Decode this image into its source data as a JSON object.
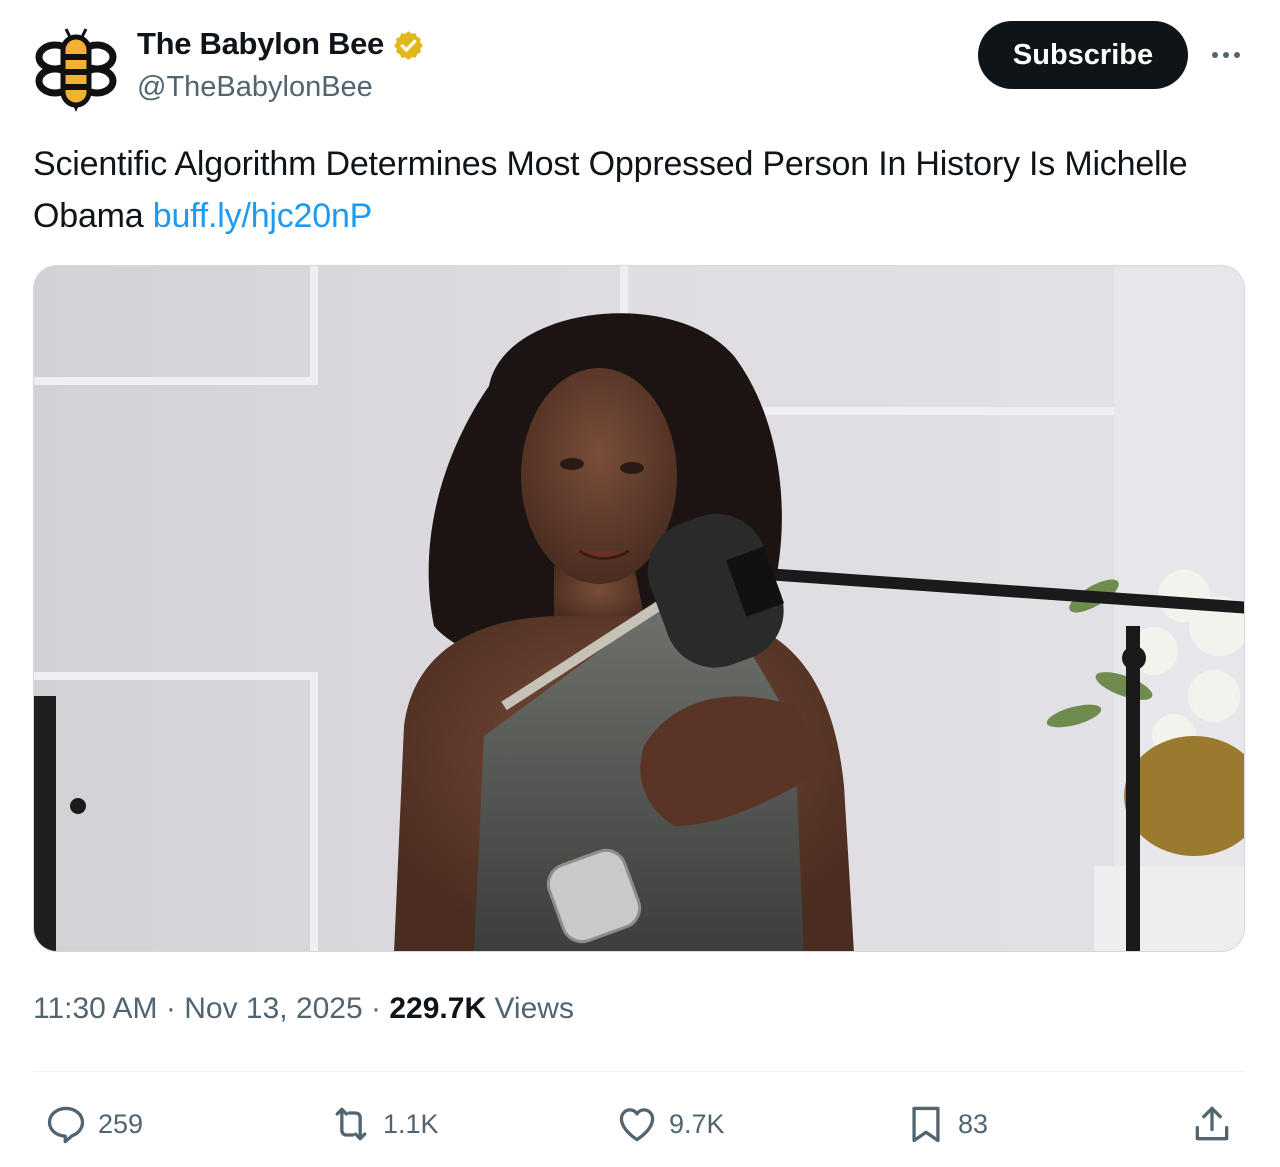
{
  "author": {
    "display_name": "The Babylon Bee",
    "handle": "@TheBabylonBee",
    "verified": true,
    "avatar_icon": "babylon-bee-logo-icon"
  },
  "header": {
    "subscribe_label": "Subscribe",
    "more_icon": "more-options-icon"
  },
  "post": {
    "text": "Scientific Algorithm Determines Most Oppressed Person In History Is Michelle Obama",
    "link": "buff.ly/hjc20nP",
    "image": {
      "description_icon": "photo-image"
    }
  },
  "meta": {
    "time": "11:30 AM",
    "separator": "·",
    "date": "Nov 13, 2025",
    "views_count": "229.7K",
    "views_label": "Views"
  },
  "actions": {
    "replies": "259",
    "reposts": "1.1K",
    "likes": "9.7K",
    "bookmarks": "83"
  },
  "colors": {
    "text": "#0f1419",
    "secondary": "#536471",
    "link": "#1d9bf0",
    "button_bg": "#0f1419",
    "verified_gold": "#e2b719"
  }
}
